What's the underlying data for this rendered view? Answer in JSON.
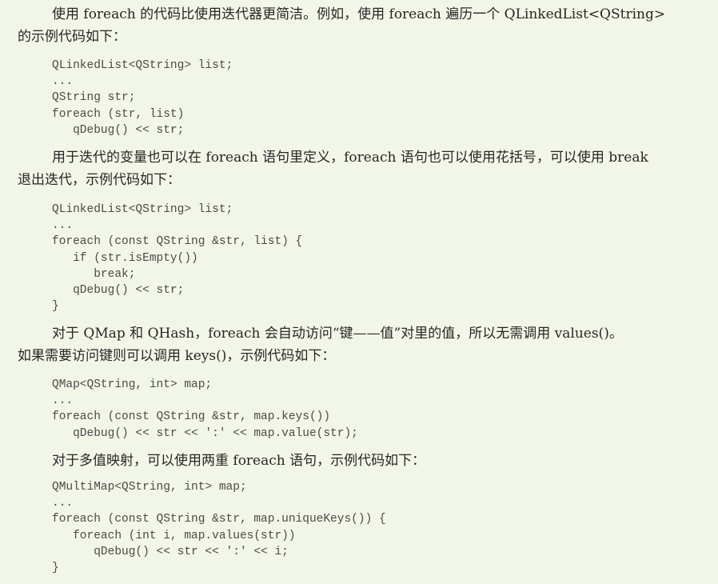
{
  "paragraphs": [
    "使用 foreach 的代码比使用迭代器更简洁。例如，使用 foreach 遍历一个 QLinkedList<QString>\n的示例代码如下：",
    "用于迭代的变量也可以在 foreach 语句里定义，foreach 语句也可以使用花括号，可以使用 break\n退出迭代，示例代码如下：",
    "对于 QMap 和 QHash，foreach 会自动访问“键——值”对里的值，所以无需调用 values()。\n如果需要访问键则可以调用 keys()，示例代码如下：",
    "对于多值映射，可以使用两重 foreach 语句，示例代码如下："
  ],
  "code_blocks": [
    [
      "QLinkedList<QString> list;",
      "...",
      "QString str;",
      "foreach (str, list)",
      "   qDebug() << str;"
    ],
    [
      "QLinkedList<QString> list;",
      "...",
      "foreach (const QString &str, list) {",
      "   if (str.isEmpty())",
      "      break;",
      "   qDebug() << str;",
      "}"
    ],
    [
      "QMap<QString, int> map;",
      "...",
      "foreach (const QString &str, map.keys())",
      "   qDebug() << str << ':' << map.value(str);"
    ],
    [
      "QMultiMap<QString, int> map;",
      "...",
      "foreach (const QString &str, map.uniqueKeys()) {",
      "   foreach (int i, map.values(str))",
      "      qDebug() << str << ':' << i;",
      "}"
    ]
  ]
}
